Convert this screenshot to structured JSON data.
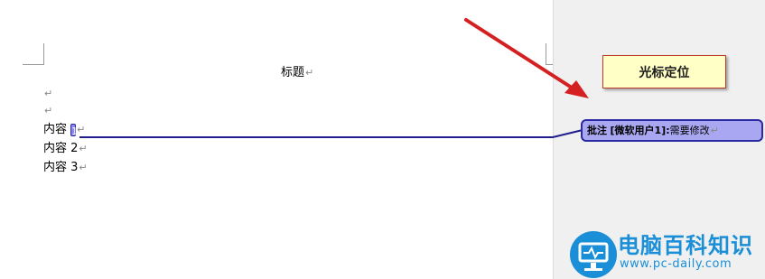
{
  "document": {
    "title": "标题",
    "para_mark": "↵",
    "lines": [
      {
        "prefix": "内容 ",
        "suffix": "1"
      },
      {
        "prefix": "内容 ",
        "suffix": "2"
      },
      {
        "prefix": "内容 ",
        "suffix": "3"
      }
    ]
  },
  "callout": {
    "label": "光标定位"
  },
  "comment": {
    "label": "批注",
    "author": "[微软用户1]:",
    "text": "需要修改"
  },
  "watermark": {
    "name": "电脑百科知识",
    "url": "www.pc-daily.com"
  },
  "colors": {
    "arrow": "#d42020",
    "comment_fill": "#a9a7f2",
    "comment_border": "#2c2aa0",
    "callout_fill": "#ffffc6",
    "logo": "#1a8fd8"
  },
  "icons": {
    "logo": "monitor-icon",
    "arrow": "red-arrow-icon"
  }
}
